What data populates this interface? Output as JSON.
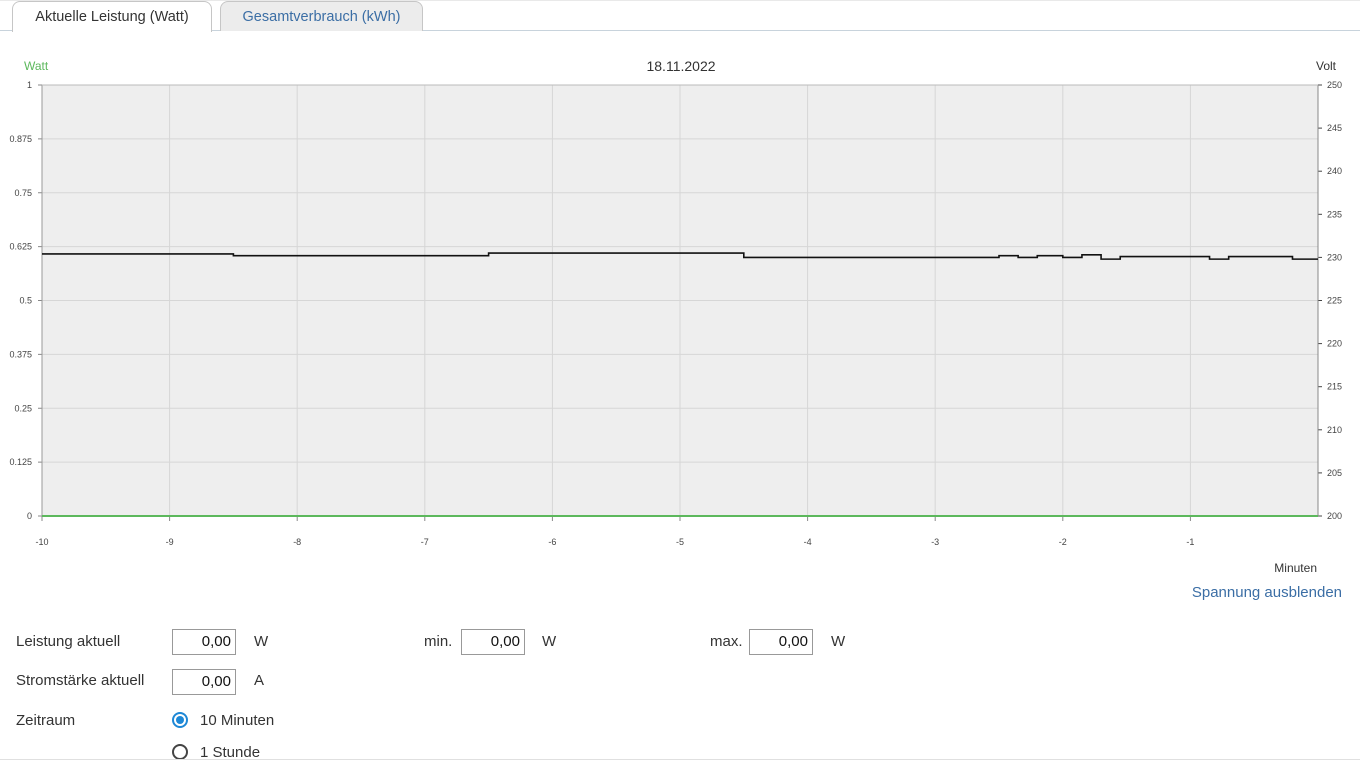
{
  "tabs": {
    "active": "Aktuelle Leistung (Watt)",
    "inactive": "Gesamtverbrauch (kWh)"
  },
  "chart": {
    "title": "18.11.2022",
    "ylabel_left": "Watt",
    "ylabel_right": "Volt",
    "xlabel": "Minuten",
    "toggle_label": "Spannung ausblenden"
  },
  "chart_data": {
    "type": "line",
    "title": "18.11.2022",
    "xlabel": "Minuten",
    "ylabel": "Watt",
    "ylabel_secondary": "Volt",
    "xlim": [
      -10,
      0
    ],
    "ylim": [
      0,
      1
    ],
    "ylim_secondary": [
      200,
      250
    ],
    "x_ticks": [
      "-10",
      "-9",
      "-8",
      "-7",
      "-6",
      "-5",
      "-4",
      "-3",
      "-2",
      "-1"
    ],
    "y_ticks": [
      "0",
      "0.125",
      "0.25",
      "0.375",
      "0.5",
      "0.625",
      "0.75",
      "0.875",
      "1"
    ],
    "y_ticks_secondary": [
      "200",
      "205",
      "210",
      "215",
      "220",
      "225",
      "230",
      "235",
      "240",
      "245",
      "250"
    ],
    "grid": true,
    "series": [
      {
        "name": "Watt",
        "axis": "left",
        "color": "#5cb85c",
        "step": false,
        "x": [
          -10,
          0
        ],
        "values": [
          0,
          0
        ]
      },
      {
        "name": "Volt",
        "axis": "right",
        "color": "#111111",
        "step": true,
        "x": [
          -10,
          -8.5,
          -6.5,
          -4.5,
          -2.5,
          -2.35,
          -2.2,
          -2.0,
          -1.85,
          -1.7,
          -1.55,
          -1.35,
          -1.0,
          -0.85,
          -0.7,
          -0.35,
          -0.2,
          0
        ],
        "values": [
          230.4,
          230.2,
          230.5,
          230.0,
          230.2,
          230.0,
          230.2,
          230.0,
          230.3,
          229.8,
          230.1,
          230.1,
          230.1,
          229.8,
          230.1,
          230.1,
          229.8,
          229.8
        ]
      }
    ]
  },
  "stats": {
    "power_label": "Leistung aktuell",
    "power_value": "0,00",
    "power_unit": "W",
    "min_label": "min.",
    "min_value": "0,00",
    "min_unit": "W",
    "max_label": "max.",
    "max_value": "0,00",
    "max_unit": "W",
    "current_label": "Stromstärke aktuell",
    "current_value": "0,00",
    "current_unit": "A"
  },
  "timerange": {
    "label": "Zeitraum",
    "options": [
      {
        "label": "10 Minuten",
        "selected": true
      },
      {
        "label": "1 Stunde",
        "selected": false
      }
    ]
  },
  "colors": {
    "accent": "#1e88d6",
    "link": "#3b6ea5",
    "watt_axis": "#5cb85c",
    "plot_background": "#eeeeee"
  }
}
